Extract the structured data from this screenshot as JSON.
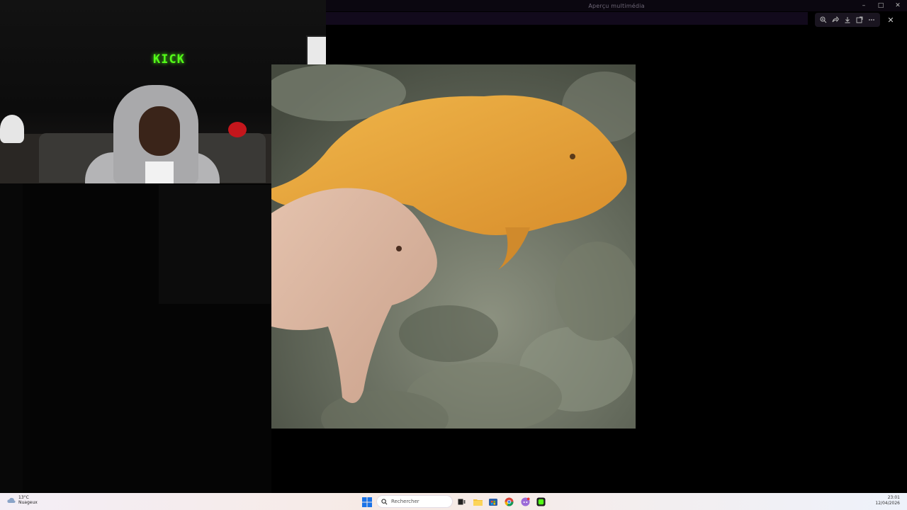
{
  "window": {
    "title": "Aperçu multimédia",
    "controls": {
      "minimize": "–",
      "maximize": "□",
      "close": "✕"
    }
  },
  "viewer_toolbar": {
    "icons": [
      "zoom-in-icon",
      "share-icon",
      "download-icon",
      "open-external-icon",
      "more-icon"
    ],
    "close": "✕"
  },
  "webcam": {
    "brand": "KICK",
    "brand_color": "#53fc18"
  },
  "taskbar": {
    "weather_temp": "13°C",
    "weather_desc": "Nuageux",
    "search_placeholder": "Rechercher",
    "time": "23:01",
    "date": "12/04/2026"
  },
  "colors": {
    "accent_bg": "#000000",
    "fish_orange": "#e8a63a",
    "fish_pale": "#d9b7a2",
    "taskbar_bg": "#f3eef6"
  }
}
